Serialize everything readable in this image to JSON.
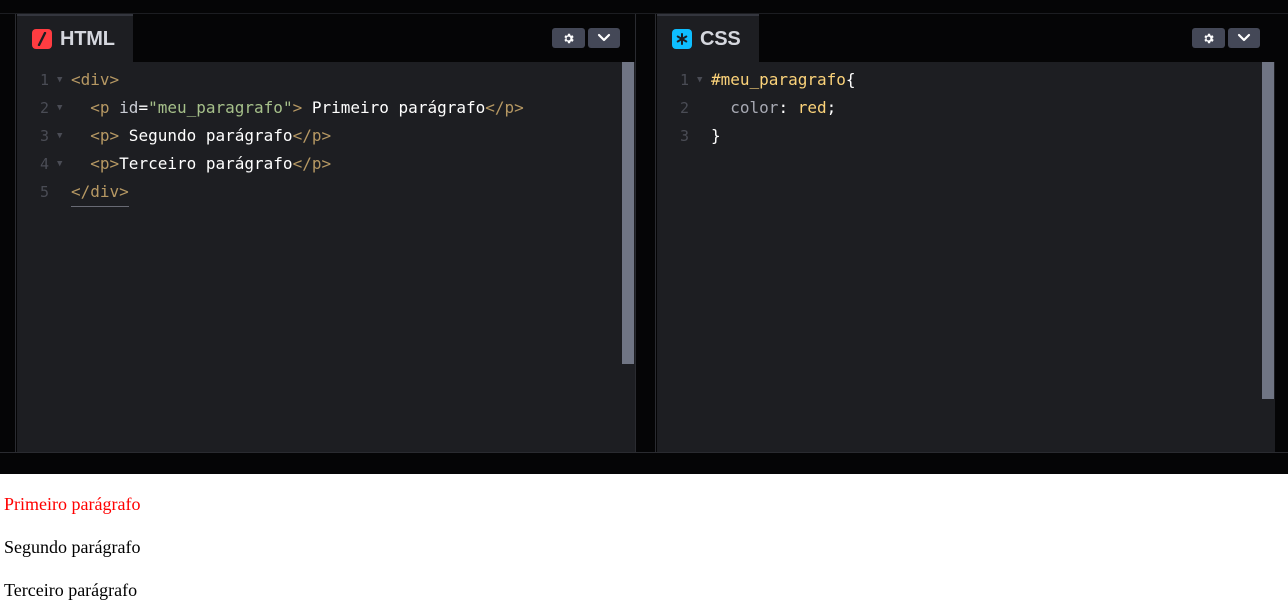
{
  "editors": {
    "html": {
      "tab_label": "HTML",
      "icon": "html-slash-icon",
      "lines": [
        {
          "n": "1",
          "parts": [
            {
              "c": "tag",
              "t": "<div>"
            }
          ]
        },
        {
          "n": "2",
          "parts": [
            {
              "c": "tag",
              "t": "  <p "
            },
            {
              "c": "attr",
              "t": "id"
            },
            {
              "c": "plain",
              "t": "="
            },
            {
              "c": "str",
              "t": "\"meu_paragrafo\""
            },
            {
              "c": "tag",
              "t": ">"
            },
            {
              "c": "plain",
              "t": " Primeiro parágrafo"
            },
            {
              "c": "tag",
              "t": "</p>"
            }
          ]
        },
        {
          "n": "3",
          "parts": [
            {
              "c": "tag",
              "t": "  <p>"
            },
            {
              "c": "plain",
              "t": " Segundo parágrafo"
            },
            {
              "c": "tag",
              "t": "</p>"
            }
          ]
        },
        {
          "n": "4",
          "parts": [
            {
              "c": "tag",
              "t": "  <p>"
            },
            {
              "c": "plain",
              "t": "Terceiro parágrafo"
            },
            {
              "c": "tag",
              "t": "</p>"
            }
          ]
        },
        {
          "n": "5",
          "parts": [
            {
              "c": "tag",
              "t": "</div>"
            }
          ]
        }
      ]
    },
    "css": {
      "tab_label": "CSS",
      "icon": "css-asterisk-icon",
      "lines": [
        {
          "n": "1",
          "parts": [
            {
              "c": "sel",
              "t": "#meu_paragrafo"
            },
            {
              "c": "plain",
              "t": "{"
            }
          ]
        },
        {
          "n": "2",
          "parts": [
            {
              "c": "prop",
              "t": "  color"
            },
            {
              "c": "plain",
              "t": ": "
            },
            {
              "c": "val",
              "t": "red"
            },
            {
              "c": "plain",
              "t": ";"
            }
          ]
        },
        {
          "n": "3",
          "parts": [
            {
              "c": "plain",
              "t": "}"
            }
          ]
        }
      ]
    }
  },
  "output": {
    "paragraphs": [
      {
        "text": "Primeiro parágrafo",
        "color": "#ff0000"
      },
      {
        "text": "Segundo parágrafo",
        "color": "#000000"
      },
      {
        "text": "Terceiro parágrafo",
        "color": "#000000"
      }
    ]
  },
  "colors": {
    "html_icon": "#ff3c41",
    "css_icon": "#0ebeff",
    "editor_bg": "#1d1e22",
    "tag": "#b69863"
  }
}
